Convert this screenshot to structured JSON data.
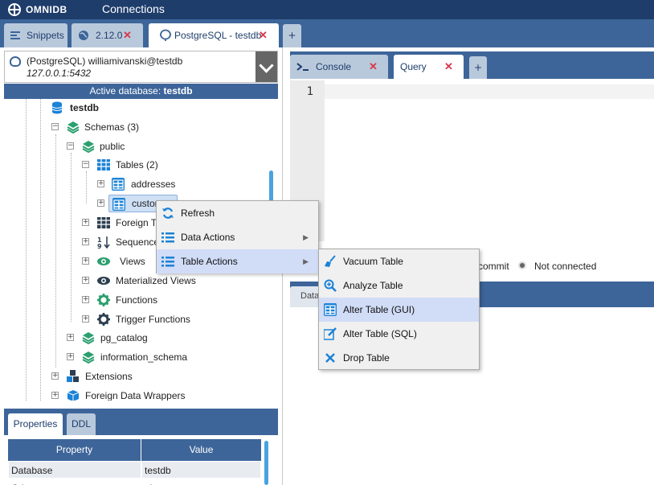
{
  "app": {
    "brand": "OMNIDB",
    "nav_connections": "Connections"
  },
  "connection_tabs": [
    {
      "label": "Snippets"
    },
    {
      "label": "2.12.0"
    },
    {
      "label": "PostgreSQL - testdb"
    }
  ],
  "add_tab": "+",
  "connection": {
    "main": "(PostgreSQL) williamivanski@testdb",
    "host": "127.0.0.1:5432"
  },
  "active_db": {
    "prefix": "Active database: ",
    "name": "testdb"
  },
  "tree": [
    {
      "label": "testdb"
    },
    {
      "label": "Schemas (3)"
    },
    {
      "label": "public"
    },
    {
      "label": "Tables (2)"
    },
    {
      "label": "addresses"
    },
    {
      "label": "custom"
    },
    {
      "label": "Foreign Ta"
    },
    {
      "label": "Sequence"
    },
    {
      "label": "Views"
    },
    {
      "label": "Materialized Views"
    },
    {
      "label": "Functions"
    },
    {
      "label": "Trigger Functions"
    },
    {
      "label": "pg_catalog"
    },
    {
      "label": "information_schema"
    },
    {
      "label": "Extensions"
    },
    {
      "label": "Foreign Data Wrappers"
    }
  ],
  "properties": {
    "tabs": [
      "Properties",
      "DDL"
    ],
    "headers": [
      "Property",
      "Value"
    ],
    "rows": [
      [
        "Database",
        "testdb"
      ],
      [
        "Oth",
        "ab"
      ]
    ]
  },
  "editor_tabs": [
    {
      "label": "Console"
    },
    {
      "label": "Query"
    }
  ],
  "editor": {
    "line_number": "1"
  },
  "status": {
    "autocommit": "commit",
    "connection": "Not connected"
  },
  "results_tab": "Data",
  "context_menu": {
    "items": [
      {
        "label": "Refresh"
      },
      {
        "label": "Data Actions"
      },
      {
        "label": "Table Actions"
      }
    ]
  },
  "submenu": {
    "items": [
      {
        "label": "Vacuum Table"
      },
      {
        "label": "Analyze Table"
      },
      {
        "label": "Alter Table (GUI)"
      },
      {
        "label": "Alter Table (SQL)"
      },
      {
        "label": "Drop Table"
      }
    ]
  },
  "colors": {
    "header": "#1e3d6b",
    "bar": "#3d6599",
    "highlight": "#d1dcf7",
    "close": "#d9364a",
    "accent_green": "#2b9f6f"
  }
}
